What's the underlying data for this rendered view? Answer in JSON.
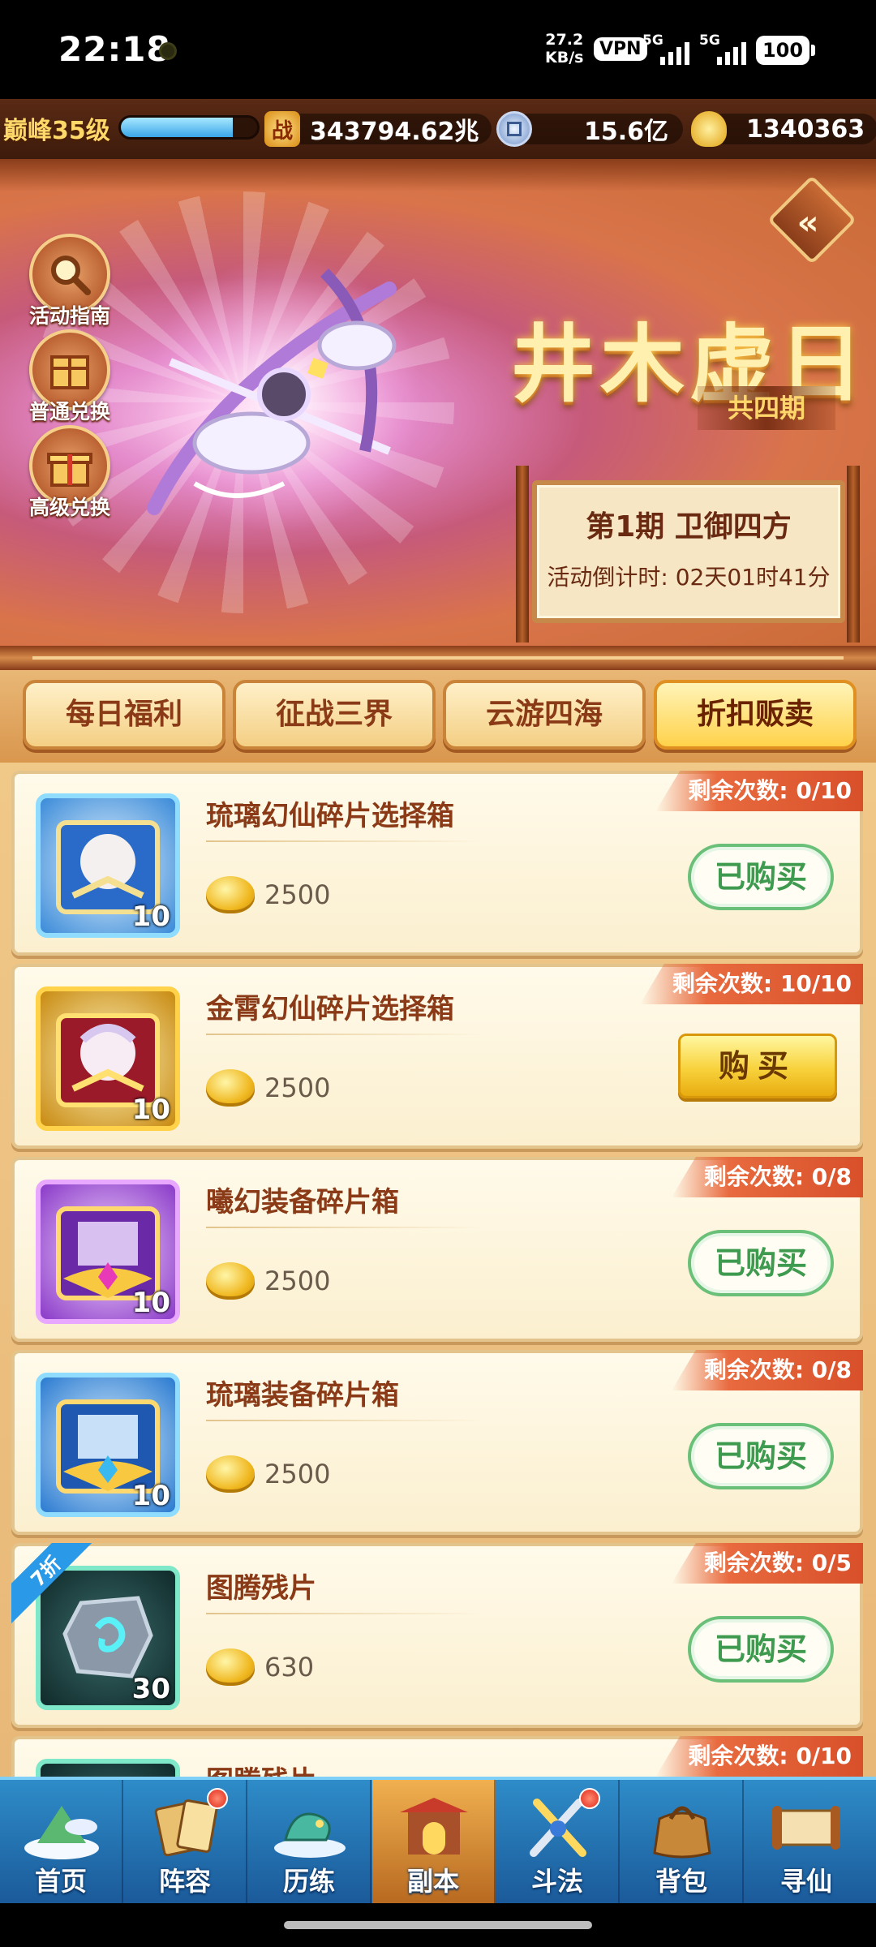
{
  "status_bar": {
    "time": "22:18",
    "net_speed_value": "27.2",
    "net_speed_unit": "KB/s",
    "vpn": "VPN",
    "sim1": "5G",
    "sim2": "5G",
    "battery": "100"
  },
  "resources": {
    "level_label": "巅峰35级",
    "xp_progress_percent": 82,
    "power_icon_char": "战",
    "power": "343794.62兆",
    "coins": "15.6亿",
    "ingots": "1340363"
  },
  "banner": {
    "side_buttons": [
      {
        "label": "活动指南",
        "icon": "magnifier-icon"
      },
      {
        "label": "普通兑换",
        "icon": "box-icon"
      },
      {
        "label": "高级兑换",
        "icon": "gift-icon"
      }
    ],
    "back_label": "«",
    "title": "井木虚日",
    "subtitle": "共四期",
    "phase_title": "第1期  卫御四方",
    "countdown": "活动倒计时: 02天01时41分"
  },
  "tabs": [
    {
      "label": "每日福利",
      "active": false
    },
    {
      "label": "征战三界",
      "active": false
    },
    {
      "label": "云游四海",
      "active": false
    },
    {
      "label": "折扣贩卖",
      "active": true
    }
  ],
  "items": [
    {
      "name": "琉璃幻仙碎片选择箱",
      "qty": "10",
      "price": "2500",
      "remaining": "剩余次数: 0/10",
      "button": "已购买",
      "state": "bought",
      "frame": "#8fdcff"
    },
    {
      "name": "金霄幻仙碎片选择箱",
      "qty": "10",
      "price": "2500",
      "remaining": "剩余次数: 10/10",
      "button": "购买",
      "state": "buy",
      "frame": "#ffd24a"
    },
    {
      "name": "曦幻装备碎片箱",
      "qty": "10",
      "price": "2500",
      "remaining": "剩余次数: 0/8",
      "button": "已购买",
      "state": "bought",
      "frame": "#e8a8ff"
    },
    {
      "name": "琉璃装备碎片箱",
      "qty": "10",
      "price": "2500",
      "remaining": "剩余次数: 0/8",
      "button": "已购买",
      "state": "bought",
      "frame": "#8fdcff"
    },
    {
      "name": "图腾残片",
      "qty": "30",
      "price": "630",
      "remaining": "剩余次数: 0/5",
      "button": "已购买",
      "state": "bought",
      "frame": "#7ee8c8",
      "discount": "7折"
    },
    {
      "name": "图腾残片",
      "remaining": "剩余次数: 0/10"
    }
  ],
  "nav": [
    {
      "label": "首页",
      "icon": "home-island-icon",
      "badge": false
    },
    {
      "label": "阵容",
      "icon": "cards-icon",
      "badge": true
    },
    {
      "label": "历练",
      "icon": "dragon-icon",
      "badge": false
    },
    {
      "label": "副本",
      "icon": "gate-icon",
      "badge": false,
      "active": true
    },
    {
      "label": "斗法",
      "icon": "swords-icon",
      "badge": true
    },
    {
      "label": "背包",
      "icon": "bag-icon",
      "badge": false
    },
    {
      "label": "寻仙",
      "icon": "scroll-icon",
      "badge": false
    }
  ],
  "colors": {
    "accent_gold": "#ffd24a",
    "title_brown": "#8a3a16",
    "bought_green": "#3e9a4e",
    "remaining_red": "#e86a3e",
    "nav_blue": "#2e8cc8"
  }
}
